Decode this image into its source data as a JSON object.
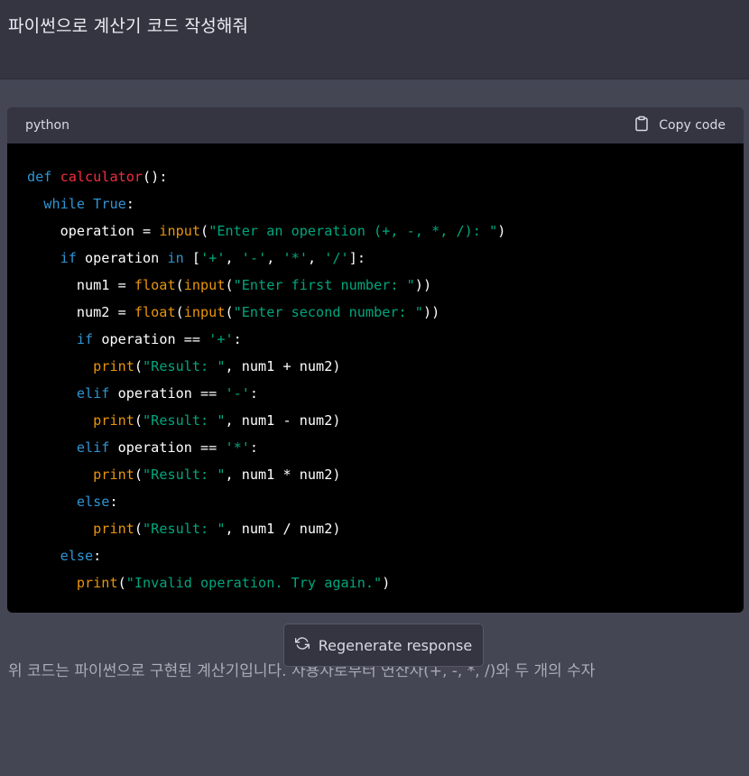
{
  "user_message": "파이썬으로 계산기 코드 작성해줘",
  "code_block": {
    "language": "python",
    "copy_label": "Copy code",
    "copy_icon": "clipboard-icon",
    "lines": [
      [
        {
          "t": "def",
          "c": "kw"
        },
        {
          "t": " ",
          "c": "pl"
        },
        {
          "t": "calculator",
          "c": "fn"
        },
        {
          "t": "():",
          "c": "pl"
        }
      ],
      [
        {
          "t": "  ",
          "c": "pl"
        },
        {
          "t": "while",
          "c": "kw"
        },
        {
          "t": " ",
          "c": "pl"
        },
        {
          "t": "True",
          "c": "kw"
        },
        {
          "t": ":",
          "c": "pl"
        }
      ],
      [
        {
          "t": "    operation = ",
          "c": "pl"
        },
        {
          "t": "input",
          "c": "bi"
        },
        {
          "t": "(",
          "c": "pl"
        },
        {
          "t": "\"Enter an operation (+, -, *, /): \"",
          "c": "str"
        },
        {
          "t": ")",
          "c": "pl"
        }
      ],
      [
        {
          "t": "    ",
          "c": "pl"
        },
        {
          "t": "if",
          "c": "kw"
        },
        {
          "t": " operation ",
          "c": "pl"
        },
        {
          "t": "in",
          "c": "kw"
        },
        {
          "t": " [",
          "c": "pl"
        },
        {
          "t": "'+'",
          "c": "str"
        },
        {
          "t": ", ",
          "c": "pl"
        },
        {
          "t": "'-'",
          "c": "str"
        },
        {
          "t": ", ",
          "c": "pl"
        },
        {
          "t": "'*'",
          "c": "str"
        },
        {
          "t": ", ",
          "c": "pl"
        },
        {
          "t": "'/'",
          "c": "str"
        },
        {
          "t": "]:",
          "c": "pl"
        }
      ],
      [
        {
          "t": "      num1 = ",
          "c": "pl"
        },
        {
          "t": "float",
          "c": "bi"
        },
        {
          "t": "(",
          "c": "pl"
        },
        {
          "t": "input",
          "c": "bi"
        },
        {
          "t": "(",
          "c": "pl"
        },
        {
          "t": "\"Enter first number: \"",
          "c": "str"
        },
        {
          "t": "))",
          "c": "pl"
        }
      ],
      [
        {
          "t": "      num2 = ",
          "c": "pl"
        },
        {
          "t": "float",
          "c": "bi"
        },
        {
          "t": "(",
          "c": "pl"
        },
        {
          "t": "input",
          "c": "bi"
        },
        {
          "t": "(",
          "c": "pl"
        },
        {
          "t": "\"Enter second number: \"",
          "c": "str"
        },
        {
          "t": "))",
          "c": "pl"
        }
      ],
      [
        {
          "t": "      ",
          "c": "pl"
        },
        {
          "t": "if",
          "c": "kw"
        },
        {
          "t": " operation == ",
          "c": "pl"
        },
        {
          "t": "'+'",
          "c": "str"
        },
        {
          "t": ":",
          "c": "pl"
        }
      ],
      [
        {
          "t": "        ",
          "c": "pl"
        },
        {
          "t": "print",
          "c": "bi"
        },
        {
          "t": "(",
          "c": "pl"
        },
        {
          "t": "\"Result: \"",
          "c": "str"
        },
        {
          "t": ", num1 + num2)",
          "c": "pl"
        }
      ],
      [
        {
          "t": "      ",
          "c": "pl"
        },
        {
          "t": "elif",
          "c": "kw"
        },
        {
          "t": " operation == ",
          "c": "pl"
        },
        {
          "t": "'-'",
          "c": "str"
        },
        {
          "t": ":",
          "c": "pl"
        }
      ],
      [
        {
          "t": "        ",
          "c": "pl"
        },
        {
          "t": "print",
          "c": "bi"
        },
        {
          "t": "(",
          "c": "pl"
        },
        {
          "t": "\"Result: \"",
          "c": "str"
        },
        {
          "t": ", num1 - num2)",
          "c": "pl"
        }
      ],
      [
        {
          "t": "      ",
          "c": "pl"
        },
        {
          "t": "elif",
          "c": "kw"
        },
        {
          "t": " operation == ",
          "c": "pl"
        },
        {
          "t": "'*'",
          "c": "str"
        },
        {
          "t": ":",
          "c": "pl"
        }
      ],
      [
        {
          "t": "        ",
          "c": "pl"
        },
        {
          "t": "print",
          "c": "bi"
        },
        {
          "t": "(",
          "c": "pl"
        },
        {
          "t": "\"Result: \"",
          "c": "str"
        },
        {
          "t": ", num1 * num2)",
          "c": "pl"
        }
      ],
      [
        {
          "t": "      ",
          "c": "pl"
        },
        {
          "t": "else",
          "c": "kw"
        },
        {
          "t": ":",
          "c": "pl"
        }
      ],
      [
        {
          "t": "        ",
          "c": "pl"
        },
        {
          "t": "print",
          "c": "bi"
        },
        {
          "t": "(",
          "c": "pl"
        },
        {
          "t": "\"Result: \"",
          "c": "str"
        },
        {
          "t": ", num1 / num2)",
          "c": "pl"
        }
      ],
      [
        {
          "t": "    ",
          "c": "pl"
        },
        {
          "t": "else",
          "c": "kw"
        },
        {
          "t": ":",
          "c": "pl"
        }
      ],
      [
        {
          "t": "      ",
          "c": "pl"
        },
        {
          "t": "print",
          "c": "bi"
        },
        {
          "t": "(",
          "c": "pl"
        },
        {
          "t": "\"Invalid operation. Try again.\"",
          "c": "str"
        },
        {
          "t": ")",
          "c": "pl"
        }
      ]
    ]
  },
  "regenerate": {
    "label": "Regenerate response",
    "icon": "refresh-icon"
  },
  "answer_text": "위 코드는 파이썬으로 구현된 계산기입니다. 사용자로부터 연산자(+, -, *, /)와 두 개의 수자",
  "colors": {
    "user_bg": "#343541",
    "assistant_bg": "#444654",
    "code_bg": "#000000",
    "code_header_bg": "#343541",
    "keyword": "#2e95d3",
    "function_name": "#f22c3d",
    "builtin": "#e9950c",
    "string": "#00a67d"
  }
}
